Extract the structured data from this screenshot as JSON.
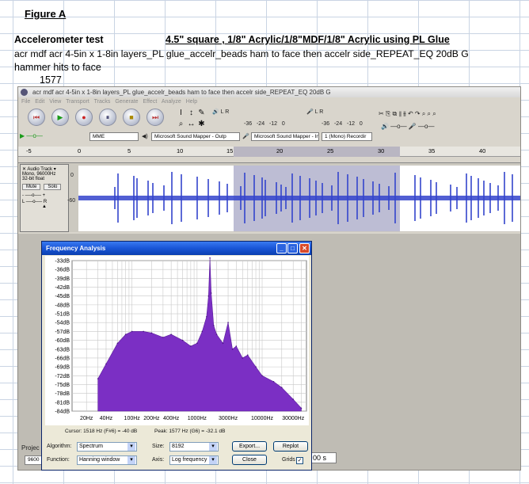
{
  "sheet": {
    "figure_label": "Figure A",
    "heading_left": "Accelerometer test",
    "heading_right": "4.5\" square , 1/8\" Acrylic/1/8\"MDF/1/8\" Acrylic  using PL Glue",
    "description_line1": "acr mdf acr 4-5in x 1-8in layers_PL glue_accelr_beads ham to face then accelr side_REPEAT_EQ 20dB G",
    "description_line2": "hammer hits to face",
    "value": "1577"
  },
  "audacity": {
    "window_title": "acr mdf acr 4-5in x 1-8in layers_PL glue_accelr_beads ham to face then accelr side_REPEAT_EQ 20dB G",
    "menu": [
      "File",
      "Edit",
      "View",
      "Transport",
      "Tracks",
      "Generate",
      "Effect",
      "Analyze",
      "Help"
    ],
    "meter_ticks_out": [
      "-36",
      "-24",
      "-12",
      "0"
    ],
    "meter_ticks_in": [
      "-36",
      "-24",
      "-12",
      "0"
    ],
    "host": "MME",
    "output_device": "Microsoft Sound Mapper - Outp",
    "input_device": "Microsoft Sound Mapper - Inpu",
    "channels": "1 (Mono) Recordir",
    "ruler_ticks": [
      "-5",
      "0",
      "5",
      "10",
      "15",
      "20",
      "25",
      "30",
      "35",
      "40"
    ],
    "track": {
      "name": "Audio Track",
      "info1": "Mono, 96000Hz",
      "info2": "32-bit float",
      "mute": "Mute",
      "solo": "Solo",
      "pan_left": "L",
      "pan_right": "R",
      "scale_top": "0",
      "scale_mid": "-60"
    },
    "project_label": "Projec",
    "project_rate": "9600",
    "selection_suffix": "00 s"
  },
  "frequency_analysis": {
    "title": "Frequency Analysis",
    "cursor_text": "Cursor: 1518 Hz (F#6) = -40 dB",
    "peak_text": "Peak: 1577 Hz (G6) = -32.1 dB",
    "algorithm_label": "Algorithm:",
    "algorithm_value": "Spectrum",
    "size_label": "Size:",
    "size_value": "8192",
    "function_label": "Function:",
    "function_value": "Hanning window",
    "axis_label": "Axis:",
    "axis_value": "Log frequency",
    "export_label": "Export...",
    "replot_label": "Replot",
    "close_label": "Close",
    "grids_label": "Grids",
    "accent_color": "#7b2fc4"
  },
  "chart_data": {
    "type": "area",
    "xscale": "log",
    "ylim": [
      -84,
      -33
    ],
    "y_tick_labels": [
      "-33dB",
      "-36dB",
      "-39dB",
      "-42dB",
      "-45dB",
      "-48dB",
      "-51dB",
      "-54dB",
      "-57dB",
      "-60dB",
      "-63dB",
      "-66dB",
      "-69dB",
      "-72dB",
      "-75dB",
      "-78dB",
      "-81dB",
      "-84dB"
    ],
    "x_tick_labels": [
      "20Hz",
      "40Hz",
      "100Hz",
      "200Hz",
      "400Hz",
      "1000Hz",
      "3000Hz",
      "10000Hz",
      "30000Hz"
    ],
    "x_tick_values": [
      20,
      40,
      100,
      200,
      400,
      1000,
      3000,
      10000,
      30000
    ],
    "xlim": [
      12,
      48000
    ],
    "x": [
      30,
      40,
      60,
      80,
      100,
      150,
      200,
      300,
      400,
      600,
      800,
      1000,
      1200,
      1400,
      1500,
      1577,
      1650,
      1800,
      2000,
      2500,
      3000,
      3500,
      4000,
      5000,
      6000,
      8000,
      10000,
      15000,
      20000,
      30000,
      40000
    ],
    "values": [
      -73,
      -68,
      -61,
      -58,
      -57,
      -57,
      -57.5,
      -59,
      -58,
      -60,
      -62,
      -61,
      -57,
      -52,
      -45,
      -32.1,
      -44,
      -55,
      -58,
      -61,
      -54,
      -63,
      -62,
      -66,
      -65,
      -69,
      -72,
      -74,
      -76,
      -80,
      -83
    ],
    "grid": true
  }
}
